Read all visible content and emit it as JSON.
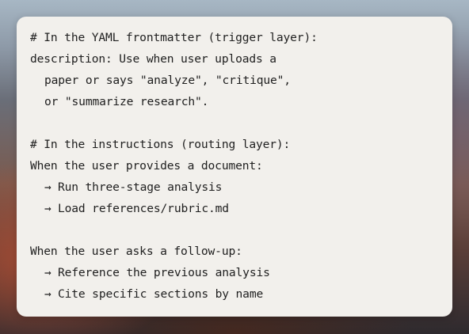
{
  "snippet": {
    "lines": [
      "# In the YAML frontmatter (trigger layer):",
      "description: Use when user uploads a",
      "paper or says \"analyze\", \"critique\",",
      "or \"summarize research\".",
      "",
      "# In the instructions (routing layer):",
      "When the user provides a document:",
      "Run three-stage analysis",
      "Load references/rubric.md",
      "",
      "When the user asks a follow-up:",
      "Reference the previous analysis",
      "Cite specific sections by name"
    ],
    "arrow_glyph": "→"
  }
}
